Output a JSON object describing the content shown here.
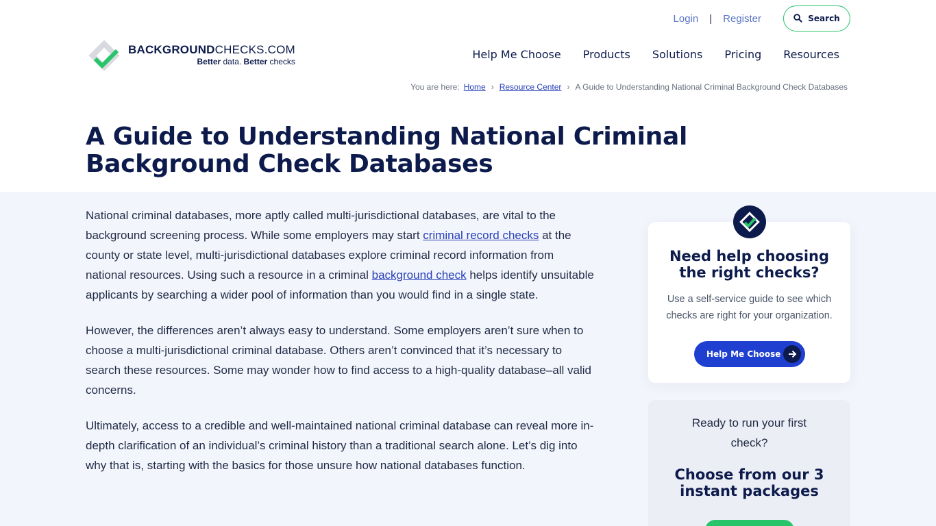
{
  "header": {
    "login_label": "Login",
    "separator": "|",
    "register_label": "Register",
    "search_label": "Search",
    "logo": {
      "name_bold": "BACKGROUND",
      "name_regular": "CHECKS.COM",
      "tag_bold_1": "Better",
      "tag_regular": " data. ",
      "tag_bold_2": "Better",
      "tag_end": " checks"
    },
    "nav": [
      {
        "label": "Help Me Choose"
      },
      {
        "label": "Products"
      },
      {
        "label": "Solutions"
      },
      {
        "label": "Pricing"
      },
      {
        "label": "Resources"
      }
    ]
  },
  "breadcrumb": {
    "prefix": "You are here:",
    "items": [
      "Home",
      "Resource Center"
    ],
    "current": "A Guide to Understanding National Criminal Background Check Databases",
    "sep": "›"
  },
  "page": {
    "title": "A Guide to Understanding National Criminal Background Check Databases"
  },
  "article": {
    "p1_a": "National criminal databases, more aptly called multi-jurisdictional databases, are vital to the background screening process. While some employers may start ",
    "p1_link1": "criminal record checks",
    "p1_b": " at the county or state level, multi-jurisdictional databases explore criminal record information from national resources. Using such a resource in a criminal ",
    "p1_link2": "background check",
    "p1_c": " helps identify unsuitable applicants by searching a wider pool of information than you would find in a single state.",
    "p2": "However, the differences aren’t always easy to understand. Some employers aren’t sure when to choose a multi-jurisdictional criminal database. Others aren’t convinced that it’s necessary to search these resources. Some may wonder how to find access to a high-quality database–all valid concerns.",
    "p3": "Ultimately, access to a credible and well-maintained national criminal database can reveal more in-depth clarification of an individual’s criminal history than a traditional search alone. Let’s dig into why that is, starting with the basics for those unsure how national databases function."
  },
  "sidebar": {
    "card1": {
      "title": "Need help choosing the right checks?",
      "text": "Use a self-service guide to see which checks are right for your organization.",
      "button": "Help Me Choose"
    },
    "card2": {
      "text": "Ready to run your first check?",
      "title": "Choose from our 3 instant packages"
    }
  },
  "colors": {
    "navy": "#0d1b4c",
    "green": "#27c46a",
    "blue": "#1f3fd0",
    "link": "#2740b8"
  }
}
